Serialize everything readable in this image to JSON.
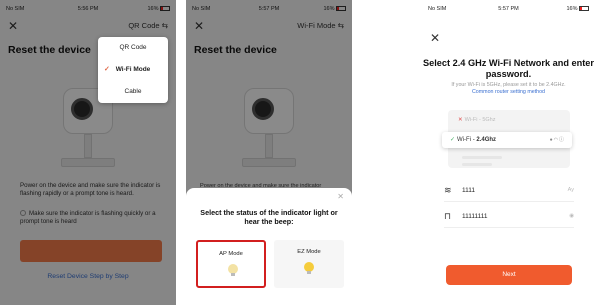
{
  "screen1": {
    "status": {
      "carrier": "No SIM",
      "time": "5:56 PM",
      "battery": "16%"
    },
    "header_right": "QR Code",
    "title": "Reset the device",
    "menu": [
      {
        "label": "QR Code",
        "selected": false
      },
      {
        "label": "Wi-Fi Mode",
        "selected": true
      },
      {
        "label": "Cable",
        "selected": false
      }
    ],
    "description": "Power on the device and make sure the indicator is flashing rapidly or a prompt tone is heard.",
    "checkbox_label": "Make sure the indicator is flashing quickly or a prompt tone is heard",
    "reset_link": "Reset Device Step by Step"
  },
  "screen2": {
    "status": {
      "carrier": "No SIM",
      "time": "5:57 PM",
      "battery": "16%"
    },
    "header_right": "Wi-Fi Mode",
    "title": "Reset the device",
    "background_text": "Power on the device and make sure the indicator",
    "sheet_title": "Select the status of the indicator light or hear the beep:",
    "modes": [
      {
        "label": "AP Mode",
        "highlighted": true
      },
      {
        "label": "EZ Mode",
        "highlighted": false
      }
    ]
  },
  "screen3": {
    "status": {
      "carrier": "No SIM",
      "time": "5:57 PM",
      "battery": "16%"
    },
    "title": "Select 2.4 GHz Wi-Fi Network and enter password.",
    "hint": "If your Wi-Fi is 5GHz, please set it to be 2.4GHz.",
    "hint_link": "Common router setting method",
    "wifi_5g": "Wi-Fi - 5Ghz",
    "wifi_24_prefix": "Wi-Fi - ",
    "wifi_24_name": "2.4Ghz",
    "ssid_value": "1111",
    "ssid_action": "Ay",
    "password_value": "11111111",
    "next_label": "Next"
  },
  "colors": {
    "accent": "#f05b2e",
    "link": "#3a6fd0",
    "highlight": "#d21f1f"
  }
}
